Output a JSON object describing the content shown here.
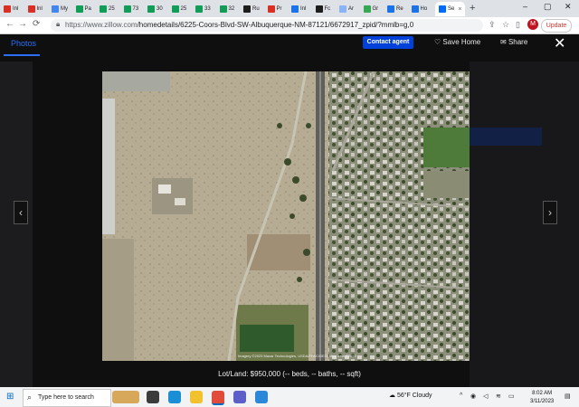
{
  "browser": {
    "tabs": [
      {
        "label": "Inl",
        "icon": "gmail-icon",
        "color": "#d93025"
      },
      {
        "label": "Inl",
        "icon": "gmail-icon",
        "color": "#d93025"
      },
      {
        "label": "My",
        "icon": "google-icon",
        "color": "#4285f4"
      },
      {
        "label": "Pa",
        "icon": "sheets-icon",
        "color": "#0f9d58"
      },
      {
        "label": "25",
        "icon": "sheets-icon",
        "color": "#0f9d58"
      },
      {
        "label": "73",
        "icon": "sheets-icon",
        "color": "#0f9d58"
      },
      {
        "label": "30",
        "icon": "sheets-icon",
        "color": "#0f9d58"
      },
      {
        "label": "25",
        "icon": "sheets-icon",
        "color": "#0f9d58"
      },
      {
        "label": "33",
        "icon": "sheets-icon",
        "color": "#0f9d58"
      },
      {
        "label": "32",
        "icon": "sheets-icon",
        "color": "#0f9d58"
      },
      {
        "label": "Ru",
        "icon": "x-icon",
        "color": "#1d1d1d"
      },
      {
        "label": "Pr",
        "icon": "doc-icon",
        "color": "#d93025"
      },
      {
        "label": "Inl",
        "icon": "globe-icon",
        "color": "#1a73e8"
      },
      {
        "label": "Fc",
        "icon": "x-icon",
        "color": "#1d1d1d"
      },
      {
        "label": "Ar",
        "icon": "shield-icon",
        "color": "#8ab4f8"
      },
      {
        "label": "Gr",
        "icon": "map-pin-icon",
        "color": "#34a853"
      },
      {
        "label": "Re",
        "icon": "map-pin-icon",
        "color": "#1a73e8"
      },
      {
        "label": "Ho",
        "icon": "map-pin-icon",
        "color": "#1a73e8"
      },
      {
        "label": "Se",
        "icon": "zillow-icon",
        "color": "#006aff"
      }
    ],
    "new_tab": "+",
    "url_host": "https://www.zillow.com",
    "url_path": "/homedetails/6225-Coors-Blvd-SW-Albuquerque-NM-87121/6672917_zpid/?mmlb=g,0",
    "profile_initial": "M",
    "update_label": "Update",
    "window_controls": [
      "–",
      "▢",
      "✕"
    ]
  },
  "lightbox": {
    "tab_label": "Photos",
    "contact_label": "Contact agent",
    "save_label": "Save Home",
    "share_label": "Share",
    "caption": "Lot/Land: $950,000 (-- beds, -- baths, -- sqft)",
    "photo_credit": "Imagery ©2023 Maxar Technologies, USDA/FPAC/GEO, Map data ©2023",
    "accent_color": "#2a6ff5",
    "contact_color": "#0041d9"
  },
  "taskbar": {
    "search_placeholder": "Type here to search",
    "weather": "56°F  Cloudy",
    "time": "8:02 AM",
    "date": "3/11/2023"
  }
}
